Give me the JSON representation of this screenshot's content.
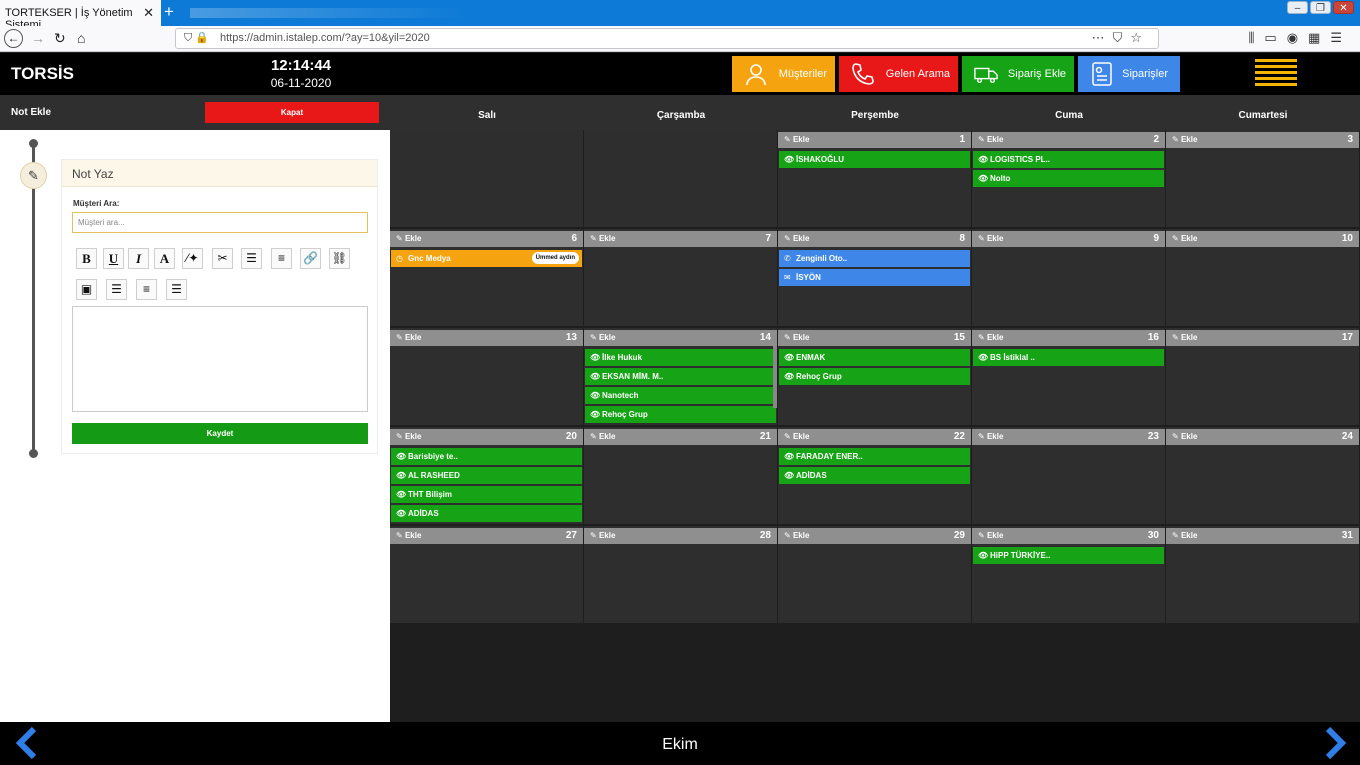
{
  "browser": {
    "tab_title": "TORTEKSER | İş Yönetim Sistemi",
    "url": "https://admin.istalep.com/?ay=10&yil=2020"
  },
  "app": {
    "brand": "TORSİS",
    "time": "12:14:44",
    "date": "06-11-2020"
  },
  "header_buttons": [
    {
      "label": "Müşteriler",
      "color": "#f5a410",
      "icon": "user-icon"
    },
    {
      "label": "Gelen Arama",
      "color": "#e81818",
      "icon": "phone-icon"
    },
    {
      "label": "Sipariş Ekle",
      "color": "#16a316",
      "icon": "truck-icon"
    },
    {
      "label": "Siparişler",
      "color": "#3e86e8",
      "icon": "order-list-icon"
    }
  ],
  "panel": {
    "title": "Not Ekle",
    "close_label": "Kapat",
    "card_title": "Not Yaz",
    "search_label": "Müşteri Ara:",
    "search_placeholder": "Müşteri ara...",
    "save_label": "Kaydet"
  },
  "calendar": {
    "days": [
      "Salı",
      "Çarşamba",
      "Perşembe",
      "Cuma",
      "Cumartesi"
    ],
    "add_label": "Ekle",
    "month": "Ekim",
    "weeks": [
      [
        {
          "num": "",
          "events": []
        },
        {
          "num": "",
          "events": []
        },
        {
          "num": "1",
          "events": [
            {
              "title": "İSHAKOĞLU",
              "type": "green",
              "icon": "eye-icon"
            }
          ]
        },
        {
          "num": "2",
          "events": [
            {
              "title": "LOGISTICS PL..",
              "type": "green",
              "icon": "eye-icon"
            },
            {
              "title": "Nolto",
              "type": "green",
              "icon": "eye-icon"
            }
          ]
        },
        {
          "num": "3",
          "events": []
        }
      ],
      [
        {
          "num": "6",
          "events": [
            {
              "title": "Gnc Medya",
              "type": "orange",
              "icon": "clock-icon",
              "badge": "Ümmed aydın"
            }
          ]
        },
        {
          "num": "7",
          "events": []
        },
        {
          "num": "8",
          "events": [
            {
              "title": "Zenginli Oto..",
              "type": "blue",
              "icon": "phone-icon"
            },
            {
              "title": "İSYÖN",
              "type": "blue",
              "icon": "mail-icon"
            }
          ]
        },
        {
          "num": "9",
          "events": []
        },
        {
          "num": "10",
          "events": []
        }
      ],
      [
        {
          "num": "13",
          "events": []
        },
        {
          "num": "14",
          "events": [
            {
              "title": "İlke Hukuk",
              "type": "green",
              "icon": "eye-icon"
            },
            {
              "title": "EKSAN MİM. M..",
              "type": "green",
              "icon": "eye-icon"
            },
            {
              "title": "Nanotech",
              "type": "green",
              "icon": "eye-icon"
            },
            {
              "title": "Rehoç Grup",
              "type": "green",
              "icon": "eye-icon"
            }
          ]
        },
        {
          "num": "15",
          "events": [
            {
              "title": "ENMAK",
              "type": "green",
              "icon": "eye-icon"
            },
            {
              "title": "Rehoç Grup",
              "type": "green",
              "icon": "eye-icon"
            }
          ]
        },
        {
          "num": "16",
          "events": [
            {
              "title": "BS İstiklal ..",
              "type": "green",
              "icon": "eye-icon"
            }
          ]
        },
        {
          "num": "17",
          "events": []
        }
      ],
      [
        {
          "num": "20",
          "events": [
            {
              "title": "Barisbiye te..",
              "type": "green",
              "icon": "eye-icon"
            },
            {
              "title": "AL RASHEED",
              "type": "green",
              "icon": "eye-icon"
            },
            {
              "title": "THT Bilişim",
              "type": "green",
              "icon": "eye-icon"
            },
            {
              "title": "ADİDAS",
              "type": "green",
              "icon": "eye-icon"
            }
          ]
        },
        {
          "num": "21",
          "events": []
        },
        {
          "num": "22",
          "events": [
            {
              "title": "FARADAY ENER..",
              "type": "green",
              "icon": "eye-icon"
            },
            {
              "title": "ADİDAS",
              "type": "green",
              "icon": "eye-icon"
            }
          ]
        },
        {
          "num": "23",
          "events": []
        },
        {
          "num": "24",
          "events": []
        }
      ],
      [
        {
          "num": "27",
          "events": []
        },
        {
          "num": "28",
          "events": []
        },
        {
          "num": "29",
          "events": []
        },
        {
          "num": "30",
          "events": [
            {
              "title": "HiPP TÜRKİYE..",
              "type": "green",
              "icon": "eye-icon"
            }
          ]
        },
        {
          "num": "31",
          "events": []
        }
      ]
    ]
  }
}
